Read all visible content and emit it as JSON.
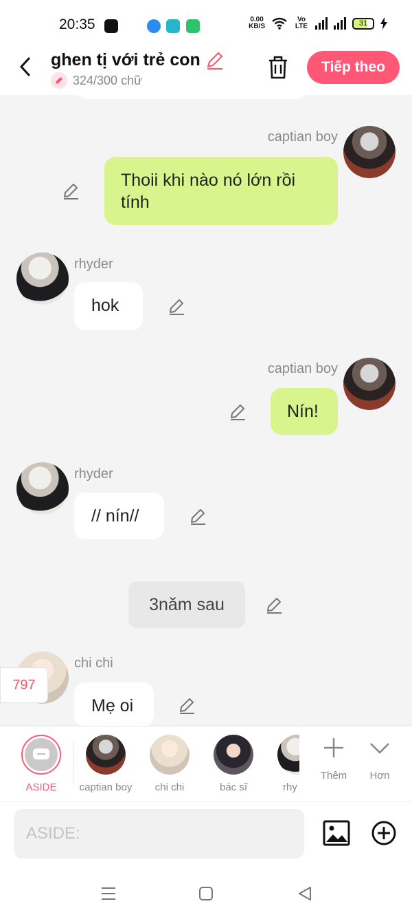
{
  "status_bar": {
    "time": "20:35",
    "speed_value": "0.00",
    "speed_unit": "KB/S",
    "volte": "Vo LTE",
    "battery": "31"
  },
  "header": {
    "title": "ghen tị với trẻ con",
    "count": "324/300 chữ",
    "next_label": "Tiếp theo"
  },
  "messages": [
    {
      "sender": "captian boy",
      "text": "Thoii khi nào nó lớn rồi tính"
    },
    {
      "sender": "rhyder",
      "text": "hok"
    },
    {
      "sender": "captian boy",
      "text": "Nín!"
    },
    {
      "sender": "rhyder",
      "text": "// nín//"
    },
    {
      "sender": "",
      "text": "3năm sau"
    },
    {
      "sender": "chi chi",
      "text": "Mẹ oi"
    }
  ],
  "floating_count": "797",
  "characters": [
    {
      "label": "ASIDE"
    },
    {
      "label": "captian boy"
    },
    {
      "label": "chi chi"
    },
    {
      "label": "bác sĩ"
    },
    {
      "label": "rhy"
    }
  ],
  "tools": {
    "more_label": "Thêm",
    "expand_label": "Hơn"
  },
  "input": {
    "placeholder": "ASIDE:"
  },
  "colors": {
    "accent": "#ff5877",
    "my_bubble": "#d7f58c",
    "their_bubble": "#ffffff",
    "background": "#f4f4f4"
  }
}
